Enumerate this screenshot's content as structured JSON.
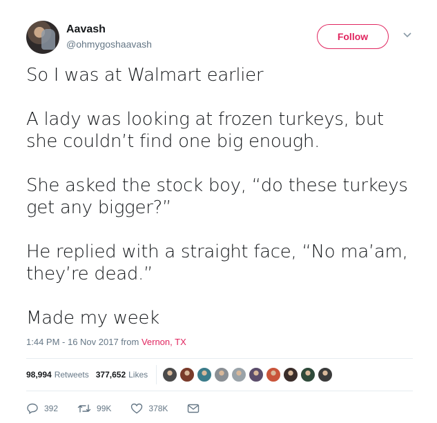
{
  "user": {
    "name": "Aavash",
    "handle": "@ohmygoshaavash"
  },
  "follow_label": "Follow",
  "tweet": {
    "paragraphs": [
      "So I was at Walmart earlier",
      "A lady was looking at frozen turkeys, but she couldn’t find one big enough.",
      "She asked the stock boy, “do these turkeys get any bigger?”",
      "He replied with a straight face, “No ma’am, they’re dead.”",
      "Made my week"
    ]
  },
  "meta": {
    "timestamp": "1:44 PM - 16 Nov 2017 from",
    "location": "Vernon, TX"
  },
  "stats": {
    "retweets_count": "98,994",
    "retweets_label": "Retweets",
    "likes_count": "377,652",
    "likes_label": "Likes"
  },
  "likers": [
    {
      "icon": "user-avatar-icon",
      "color": "#4a4a4a"
    },
    {
      "icon": "user-avatar-icon",
      "color": "#7a3b2a"
    },
    {
      "icon": "user-avatar-icon",
      "color": "#3b7c8a"
    },
    {
      "icon": "user-avatar-icon",
      "color": "#8a8f94"
    },
    {
      "icon": "user-avatar-icon",
      "color": "#9aa3a9"
    },
    {
      "icon": "user-avatar-icon",
      "color": "#5b4d6b"
    },
    {
      "icon": "user-avatar-icon",
      "color": "#c9543a"
    },
    {
      "icon": "user-avatar-icon",
      "color": "#3a2d2a"
    },
    {
      "icon": "user-avatar-icon",
      "color": "#2f4a3a"
    },
    {
      "icon": "user-avatar-icon",
      "color": "#3b3b3b"
    }
  ],
  "actions": {
    "replies": "392",
    "retweets": "99K",
    "likes": "378K"
  },
  "colors": {
    "accent": "#e0245e",
    "text": "#14171a",
    "muted": "#657786",
    "divider": "#e6ecf0"
  }
}
